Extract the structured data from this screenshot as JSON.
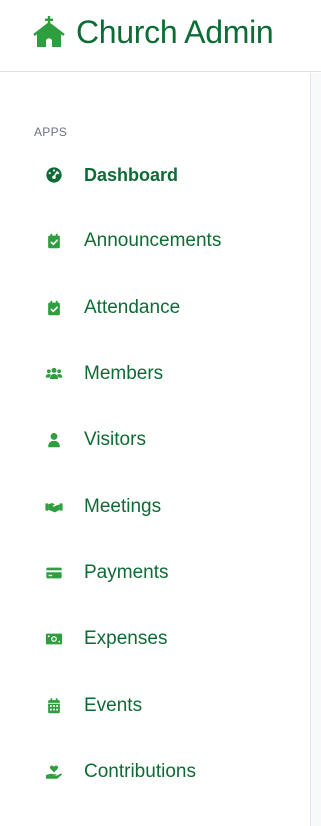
{
  "brand": {
    "title": "Church Admin",
    "icon": "church-icon"
  },
  "sidebar": {
    "section_label": "APPS",
    "items": [
      {
        "label": "Dashboard",
        "icon": "gauge-icon",
        "active": true
      },
      {
        "label": "Announcements",
        "icon": "calendar-check-icon",
        "active": false
      },
      {
        "label": "Attendance",
        "icon": "calendar-check-icon",
        "active": false
      },
      {
        "label": "Members",
        "icon": "users-icon",
        "active": false
      },
      {
        "label": "Visitors",
        "icon": "user-icon",
        "active": false
      },
      {
        "label": "Meetings",
        "icon": "handshake-icon",
        "active": false
      },
      {
        "label": "Payments",
        "icon": "credit-card-icon",
        "active": false
      },
      {
        "label": "Expenses",
        "icon": "money-bill-icon",
        "active": false
      },
      {
        "label": "Events",
        "icon": "calendar-grid-icon",
        "active": false
      },
      {
        "label": "Contributions",
        "icon": "hand-holding-heart-icon",
        "active": false
      }
    ]
  },
  "colors": {
    "brand_green": "#0f6b35",
    "icon_green": "#2f9e3f",
    "muted_text": "#6b7183"
  }
}
